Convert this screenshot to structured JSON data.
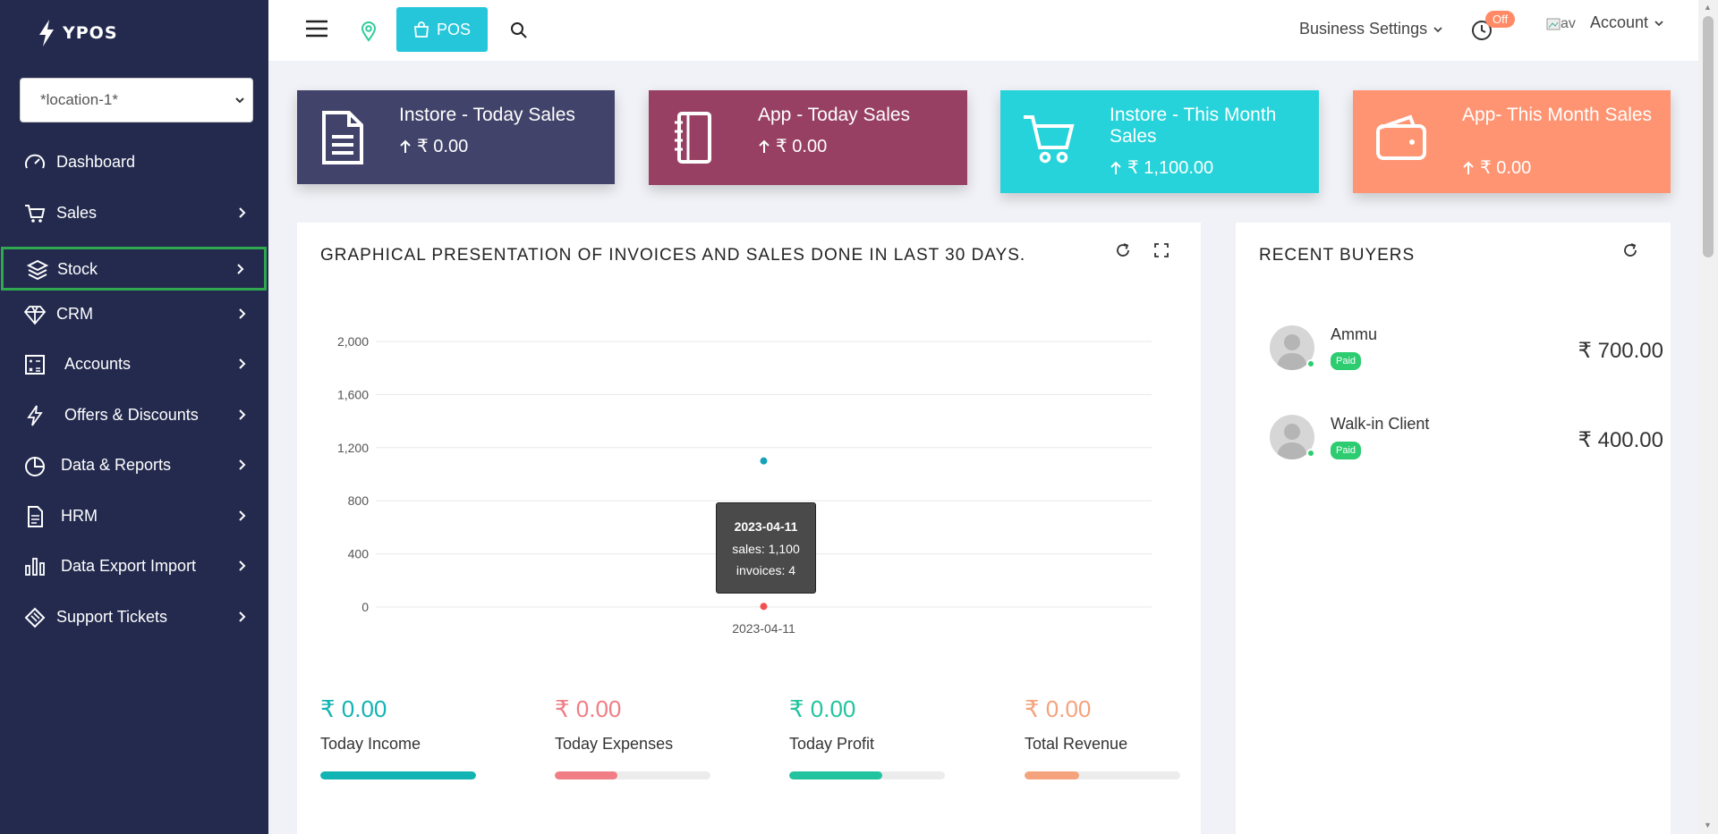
{
  "sidebar": {
    "logo": "YPOS",
    "location_select": "*location-1*",
    "items": [
      {
        "label": "Dashboard",
        "icon": "gauge-icon"
      },
      {
        "label": "Sales",
        "icon": "cart-icon"
      },
      {
        "label": "Stock",
        "icon": "layers-icon"
      },
      {
        "label": "CRM",
        "icon": "diamond-icon"
      },
      {
        "label": "Accounts",
        "icon": "ledger-icon"
      },
      {
        "label": "Offers & Discounts",
        "icon": "bolt-icon"
      },
      {
        "label": "Data & Reports",
        "icon": "pie-icon"
      },
      {
        "label": "HRM",
        "icon": "document-icon"
      },
      {
        "label": "Data Export Import",
        "icon": "bar-chart-icon"
      },
      {
        "label": "Support Tickets",
        "icon": "ticket-icon"
      }
    ]
  },
  "topbar": {
    "pos_label": "POS",
    "business_settings": "Business Settings",
    "off_badge": "Off",
    "avatar_alt": "av",
    "account": "Account"
  },
  "stats": [
    {
      "title": "Instore - Today Sales",
      "value": "₹ 0.00",
      "color": "#41436a",
      "icon": "document-icon"
    },
    {
      "title": "App - Today Sales",
      "value": "₹ 0.00",
      "color": "#974063",
      "icon": "notebook-icon"
    },
    {
      "title": "Instore - This Month Sales",
      "value": "₹ 1,100.00",
      "color": "#26d3da",
      "icon": "cart-icon"
    },
    {
      "title": "App- This Month Sales",
      "value": "₹ 0.00",
      "color": "#ff9472",
      "icon": "wallet-icon"
    }
  ],
  "chart_card": {
    "title": "GRAPHICAL PRESENTATION OF INVOICES AND SALES DONE IN LAST 30 DAYS."
  },
  "chart_data": {
    "type": "scatter",
    "x": [
      "2023-04-11"
    ],
    "series": [
      {
        "name": "sales",
        "values": [
          1100
        ],
        "color": "#17a2b8"
      },
      {
        "name": "invoices",
        "values": [
          4
        ],
        "color": "#f05050"
      }
    ],
    "ylim": [
      0,
      2000
    ],
    "yticks": [
      "0",
      "400",
      "800",
      "1,200",
      "1,600",
      "2,000"
    ],
    "grid": true,
    "tooltip": {
      "date": "2023-04-11",
      "sales": "sales: 1,100",
      "invoices": "invoices: 4"
    }
  },
  "summary": [
    {
      "value": "₹ 0.00",
      "label": "Today Income",
      "color": "#11b3b3",
      "progress": 1.0
    },
    {
      "value": "₹ 0.00",
      "label": "Today Expenses",
      "color": "#f07e84",
      "progress": 0.4
    },
    {
      "value": "₹ 0.00",
      "label": "Today Profit",
      "color": "#22c39e",
      "progress": 0.6
    },
    {
      "value": "₹ 0.00",
      "label": "Total Revenue",
      "color": "#f4a37c",
      "progress": 0.35
    }
  ],
  "recent_buyers": {
    "title": "RECENT BUYERS",
    "buyers": [
      {
        "name": "Ammu",
        "status": "Paid",
        "amount": "₹ 700.00"
      },
      {
        "name": "Walk-in Client",
        "status": "Paid",
        "amount": "₹ 400.00"
      }
    ]
  }
}
